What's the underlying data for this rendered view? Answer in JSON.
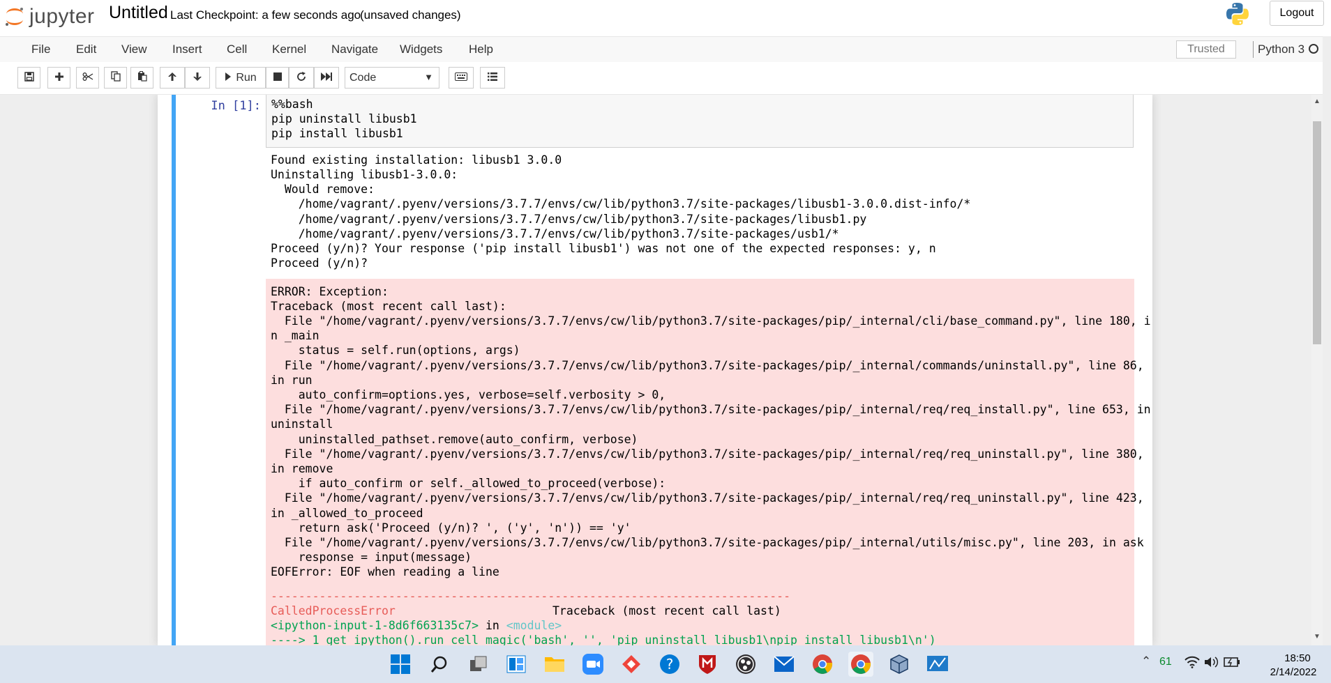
{
  "header": {
    "logo_text": "jupyter",
    "notebook_name": "Untitled",
    "checkpoint": "Last Checkpoint: a few seconds ago",
    "autosave": "(unsaved changes)",
    "logout_label": "Logout"
  },
  "menubar": {
    "items": [
      "File",
      "Edit",
      "View",
      "Insert",
      "Cell",
      "Kernel",
      "Navigate",
      "Widgets",
      "Help"
    ],
    "trusted_label": "Trusted",
    "kernel_name": "Python 3"
  },
  "toolbar": {
    "run_label": "Run",
    "cell_type": "Code",
    "icons": [
      "save-icon",
      "plus-icon",
      "scissors-icon",
      "copy-icon",
      "paste-icon",
      "arrow-up-icon",
      "arrow-down-icon",
      "step-forward-icon",
      "stop-icon",
      "restart-icon",
      "fast-forward-icon",
      "keyboard-icon",
      "list-icon"
    ]
  },
  "cell": {
    "prompt": "In [1]:",
    "code": [
      "%%bash",
      "pip uninstall libusb1",
      "pip install libusb1"
    ],
    "stdout": [
      "Found existing installation: libusb1 3.0.0",
      "Uninstalling libusb1-3.0.0:",
      "  Would remove:",
      "    /home/vagrant/.pyenv/versions/3.7.7/envs/cw/lib/python3.7/site-packages/libusb1-3.0.0.dist-info/*",
      "    /home/vagrant/.pyenv/versions/3.7.7/envs/cw/lib/python3.7/site-packages/libusb1.py",
      "    /home/vagrant/.pyenv/versions/3.7.7/envs/cw/lib/python3.7/site-packages/usb1/*",
      "Proceed (y/n)? Your response ('pip install libusb1') was not one of the expected responses: y, n",
      "Proceed (y/n)?"
    ],
    "stderr": [
      "ERROR: Exception:",
      "Traceback (most recent call last):",
      "  File \"/home/vagrant/.pyenv/versions/3.7.7/envs/cw/lib/python3.7/site-packages/pip/_internal/cli/base_command.py\", line 180, i",
      "n _main",
      "    status = self.run(options, args)",
      "  File \"/home/vagrant/.pyenv/versions/3.7.7/envs/cw/lib/python3.7/site-packages/pip/_internal/commands/uninstall.py\", line 86,",
      "in run",
      "    auto_confirm=options.yes, verbose=self.verbosity > 0,",
      "  File \"/home/vagrant/.pyenv/versions/3.7.7/envs/cw/lib/python3.7/site-packages/pip/_internal/req/req_install.py\", line 653, in",
      "uninstall",
      "    uninstalled_pathset.remove(auto_confirm, verbose)",
      "  File \"/home/vagrant/.pyenv/versions/3.7.7/envs/cw/lib/python3.7/site-packages/pip/_internal/req/req_uninstall.py\", line 380,",
      "in remove",
      "    if auto_confirm or self._allowed_to_proceed(verbose):",
      "  File \"/home/vagrant/.pyenv/versions/3.7.7/envs/cw/lib/python3.7/site-packages/pip/_internal/req/req_uninstall.py\", line 423,",
      "in _allowed_to_proceed",
      "    return ask('Proceed (y/n)? ', ('y', 'n')) == 'y'",
      "  File \"/home/vagrant/.pyenv/versions/3.7.7/envs/cw/lib/python3.7/site-packages/pip/_internal/utils/misc.py\", line 203, in ask",
      "    response = input(message)",
      "EOFError: EOF when reading a line"
    ],
    "traceback": {
      "separator": "---------------------------------------------------------------------------",
      "error_name": "CalledProcessError",
      "traceback_label": "Traceback (most recent call last)",
      "input_ref": "<ipython-input-1-8d6f663135c7>",
      "in_text": " in ",
      "module_ref": "<module>",
      "arrow_line": "----> 1 get_ipython().run_cell_magic('bash', '', 'pip uninstall libusb1\\npip install libusb1\\n')"
    }
  },
  "taskbar": {
    "apps": [
      "windows-start-icon",
      "search-icon",
      "task-view-icon",
      "widgets-icon",
      "file-explorer-icon",
      "zoom-icon",
      "anydesk-icon",
      "help-icon",
      "mcafee-icon",
      "obs-icon",
      "mail-icon",
      "chrome-icon",
      "chrome-active-icon",
      "virtualbox-icon",
      "network-tool-icon"
    ],
    "battery_pct": "61",
    "time": "18:50",
    "date": "2/14/2022"
  },
  "colors": {
    "cell_bar": "#42a5f5",
    "prompt": "#303f9f",
    "stderr_bg": "#fddede",
    "error_red": "#e75c58",
    "ansi_green": "#00a250",
    "ansi_cyan": "#60c6c8"
  }
}
